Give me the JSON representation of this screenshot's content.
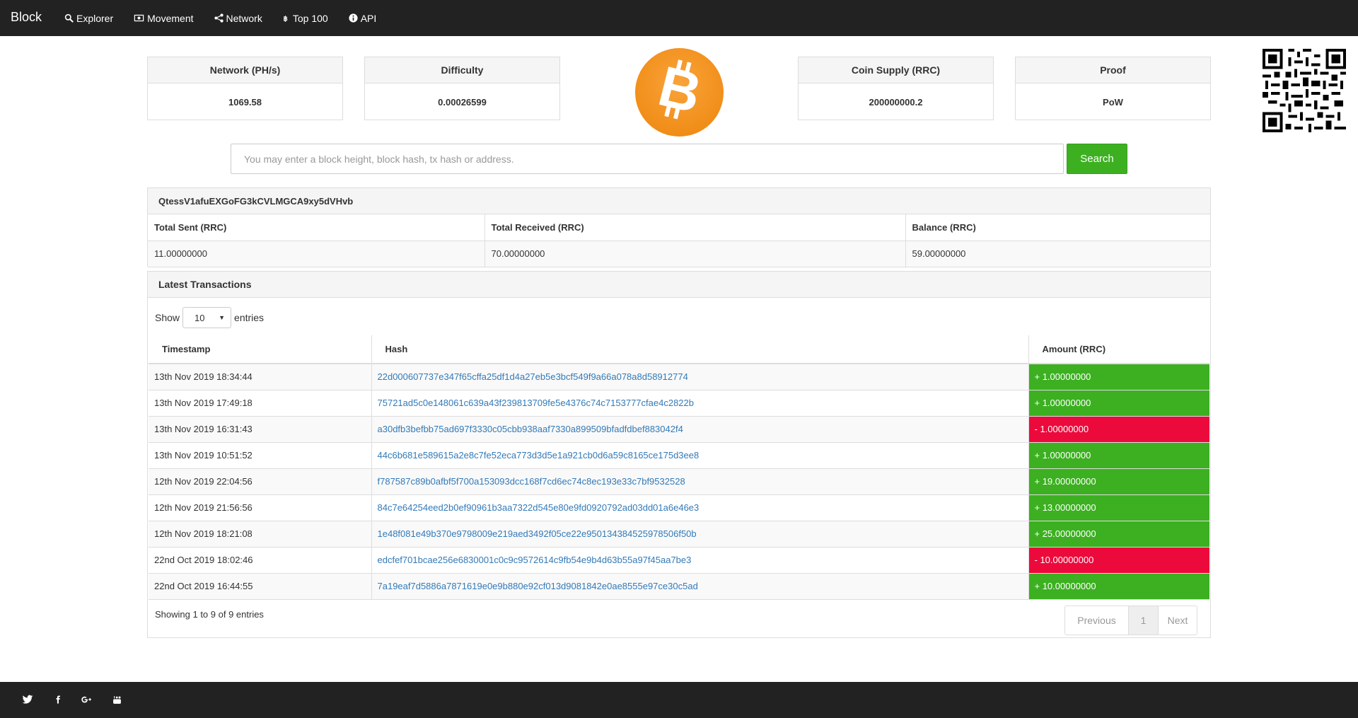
{
  "nav": {
    "brand": "Block",
    "items": [
      {
        "label": "Explorer",
        "icon": "search-icon"
      },
      {
        "label": "Movement",
        "icon": "money-icon"
      },
      {
        "label": "Network",
        "icon": "share-icon"
      },
      {
        "label": "Top 100",
        "icon": "bitcoin-icon"
      },
      {
        "label": "API",
        "icon": "info-icon"
      }
    ]
  },
  "stats": [
    {
      "label": "Network (PH/s)",
      "value": "1069.58"
    },
    {
      "label": "Difficulty",
      "value": "0.00026599"
    },
    {
      "label": "Coin Supply (RRC)",
      "value": "200000000.2"
    },
    {
      "label": "Proof",
      "value": "PoW"
    }
  ],
  "colors": {
    "accent": "#3cb021",
    "negative": "#ec0a3c",
    "link": "#337ab7",
    "bitcoin": "#f7931a",
    "navbar": "#222222"
  },
  "search": {
    "placeholder": "You may enter a block height, block hash, tx hash or address.",
    "button_label": "Search"
  },
  "address": {
    "value": "QtessV1afuEXGoFG3kCVLMGCA9xy5dVHvb",
    "headers": [
      "Total Sent (RRC)",
      "Total Received (RRC)",
      "Balance (RRC)"
    ],
    "values": [
      "11.00000000",
      "70.00000000",
      "59.00000000"
    ]
  },
  "transactions": {
    "title": "Latest Transactions",
    "show_label": "Show",
    "entries_label": "entries",
    "page_length": "10",
    "headers": [
      "Timestamp",
      "Hash",
      "Amount (RRC)"
    ],
    "rows": [
      {
        "timestamp": "13th Nov 2019 18:34:44",
        "hash": "22d000607737e347f65cffa25df1d4a27eb5e3bcf549f9a66a078a8d58912774",
        "amount": "+ 1.00000000",
        "sign": "pos"
      },
      {
        "timestamp": "13th Nov 2019 17:49:18",
        "hash": "75721ad5c0e148061c639a43f239813709fe5e4376c74c7153777cfae4c2822b",
        "amount": "+ 1.00000000",
        "sign": "pos"
      },
      {
        "timestamp": "13th Nov 2019 16:31:43",
        "hash": "a30dfb3befbb75ad697f3330c05cbb938aaf7330a899509bfadfdbef883042f4",
        "amount": "- 1.00000000",
        "sign": "neg"
      },
      {
        "timestamp": "13th Nov 2019 10:51:52",
        "hash": "44c6b681e589615a2e8c7fe52eca773d3d5e1a921cb0d6a59c8165ce175d3ee8",
        "amount": "+ 1.00000000",
        "sign": "pos"
      },
      {
        "timestamp": "12th Nov 2019 22:04:56",
        "hash": "f787587c89b0afbf5f700a153093dcc168f7cd6ec74c8ec193e33c7bf9532528",
        "amount": "+ 19.00000000",
        "sign": "pos"
      },
      {
        "timestamp": "12th Nov 2019 21:56:56",
        "hash": "84c7e64254eed2b0ef90961b3aa7322d545e80e9fd0920792ad03dd01a6e46e3",
        "amount": "+ 13.00000000",
        "sign": "pos"
      },
      {
        "timestamp": "12th Nov 2019 18:21:08",
        "hash": "1e48f081e49b370e9798009e219aed3492f05ce22e950134384525978506f50b",
        "amount": "+ 25.00000000",
        "sign": "pos"
      },
      {
        "timestamp": "22nd Oct 2019 18:02:46",
        "hash": "edcfef701bcae256e6830001c0c9c9572614c9fb54e9b4d63b55a97f45aa7be3",
        "amount": "- 10.00000000",
        "sign": "neg"
      },
      {
        "timestamp": "22nd Oct 2019 16:44:55",
        "hash": "7a19eaf7d5886a7871619e0e9b880e92cf013d9081842e0ae8555e97ce30c5ad",
        "amount": "+ 10.00000000",
        "sign": "pos"
      }
    ],
    "showing": "Showing 1 to 9 of 9 entries",
    "pagination": {
      "previous": "Previous",
      "page": "1",
      "next": "Next"
    }
  },
  "footer": {
    "icons": [
      "twitter-icon",
      "facebook-icon",
      "google-plus-icon",
      "youtube-icon"
    ]
  }
}
